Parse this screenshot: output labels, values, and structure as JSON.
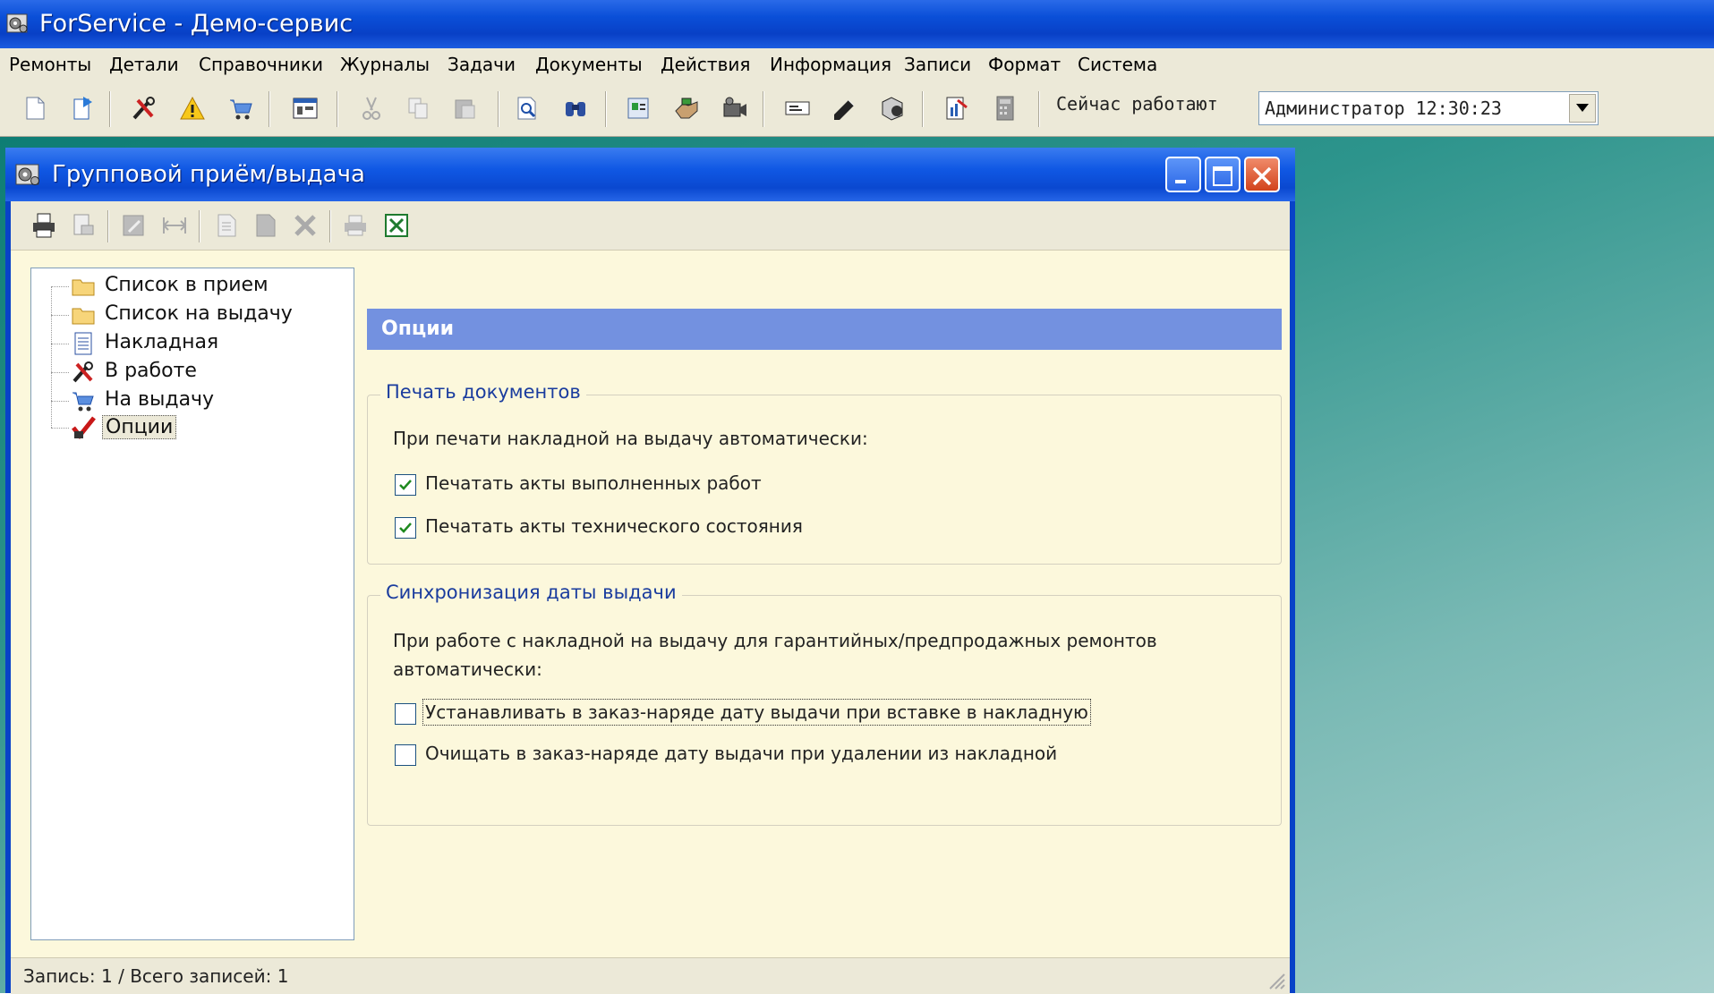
{
  "app": {
    "title": "ForService - Демо-сервис",
    "menu": [
      "Ремонты",
      "Детали",
      "Справочники",
      "Журналы",
      "Задачи",
      "Документы",
      "Действия",
      "Информация",
      "Записи",
      "Формат",
      "Система"
    ],
    "now_label": "Сейчас работают",
    "user_combo_value": "Администратор 12:30:23"
  },
  "child": {
    "title": "Групповой приём/выдача",
    "tree": [
      "Список в прием",
      "Список на выдачу",
      "Накладная",
      "В работе",
      "На выдачу",
      "Опции"
    ],
    "selected_tree": "Опции",
    "panel_title": "Опции",
    "print_group": {
      "legend": "Печать документов",
      "text": "При печати накладной на выдачу автоматически:",
      "options": [
        {
          "label": "Печатать акты выполненных работ",
          "checked": true
        },
        {
          "label": "Печатать акты технического состояния",
          "checked": true
        }
      ]
    },
    "sync_group": {
      "legend": "Синхронизация даты выдачи",
      "text_line1": "При работе с накладной на выдачу для гарантийных/предпродажных ремонтов",
      "text_line2": "автоматически:",
      "options": [
        {
          "label": "Устанавливать в заказ-наряде дату выдачи при вставке в накладную",
          "checked": false
        },
        {
          "label": "Очищать в заказ-наряде дату выдачи при удалении из накладной",
          "checked": false
        }
      ]
    },
    "status": "Запись: 1 / Всего записей: 1"
  },
  "colors": {
    "accent": "#7391e0",
    "title_blue": "#0a4fd8",
    "panel_bg": "#fcf8dc",
    "legend": "#1a3c9e"
  }
}
